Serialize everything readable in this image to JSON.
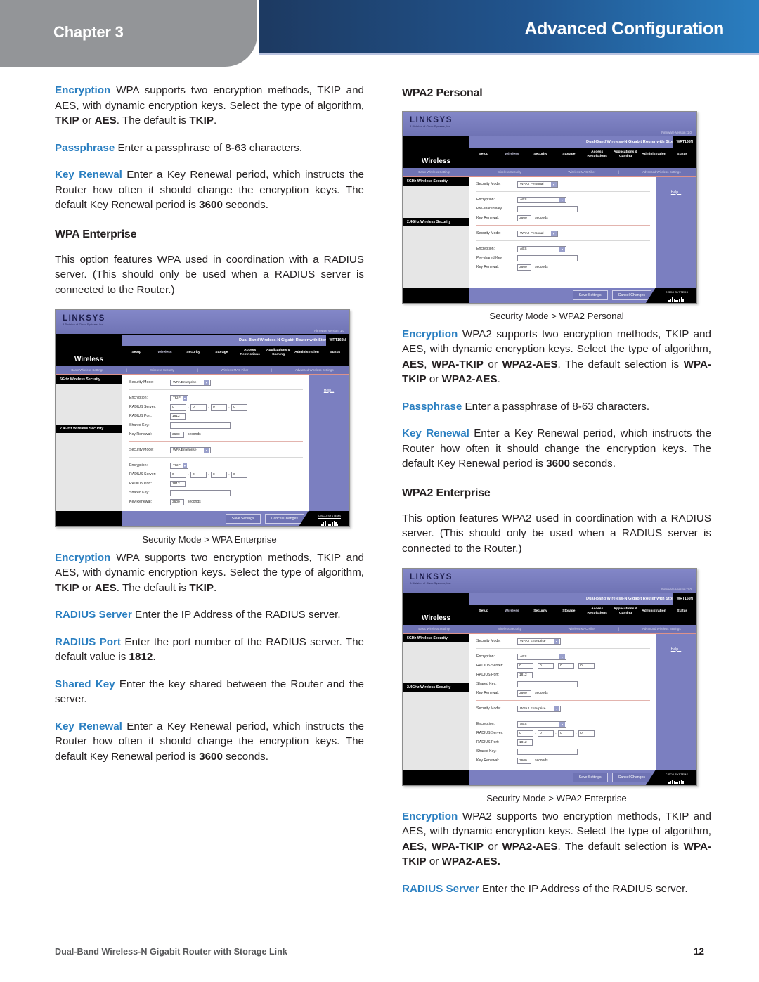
{
  "header": {
    "chapter": "Chapter 3",
    "title": "Advanced Configuration"
  },
  "left_column": {
    "para_encryption_wpa": {
      "term": "Encryption",
      "text_1": "  WPA supports two encryption methods, TKIP and AES, with dynamic encryption keys. Select the type of algorithm, ",
      "bold_1": "TKIP",
      "text_2": " or ",
      "bold_2": "AES",
      "text_3": ".  The default is ",
      "bold_3": "TKIP",
      "text_4": "."
    },
    "para_passphrase": {
      "term": "Passphrase",
      "text_1": "  Enter a passphrase of 8-63 characters."
    },
    "para_key_renewal": {
      "term": "Key Renewal",
      "text_1": "  Enter a Key Renewal period, which instructs the Router how often it should change the encryption keys. The default Key Renewal period is ",
      "bold_1": "3600",
      "text_2": " seconds."
    },
    "heading_wpa_enterprise": "WPA Enterprise",
    "para_wpa_enterprise_intro": "This option features WPA used in coordination with a RADIUS server. (This should only be used when a RADIUS server is connected to the Router.)",
    "figure_caption": "Security Mode > WPA Enterprise",
    "para_encryption_wpa2": {
      "term": "Encryption",
      "text_1": "  WPA supports two encryption methods, TKIP and AES, with dynamic encryption keys. Select the type of algorithm, ",
      "bold_1": "TKIP",
      "text_2": " or ",
      "bold_2": "AES",
      "text_3": ". The default is ",
      "bold_3": "TKIP",
      "text_4": "."
    },
    "para_radius_server": {
      "term": "RADIUS Server",
      "text_1": "  Enter the IP Address of the RADIUS server."
    },
    "para_radius_port": {
      "term": "RADIUS Port",
      "text_1": "  Enter the port number of the RADIUS server. The default value is ",
      "bold_1": "1812",
      "text_2": "."
    },
    "para_shared_key": {
      "term": "Shared Key",
      "text_1": "  Enter the key shared between the Router and the server."
    },
    "para_key_renewal_2": {
      "term": "Key Renewal",
      "text_1": "  Enter a Key Renewal period, which instructs the Router how often it should change the encryption keys. The default Key Renewal period is ",
      "bold_1": "3600",
      "text_2": " seconds."
    }
  },
  "right_column": {
    "heading_wpa2_personal": "WPA2 Personal",
    "figure_caption_1": "Security Mode > WPA2 Personal",
    "para_encryption_1": {
      "term": "Encryption",
      "text_1": " WPA2 supports two encryption methods, TKIP and AES, with dynamic encryption keys. Select the type of algorithm, ",
      "bold_1": "AES",
      "text_2": ", ",
      "bold_2": "WPA-TKIP",
      "text_3": " or ",
      "bold_3": "WPA2-AES",
      "text_4": ". The default selection is ",
      "bold_4": "WPA-TKIP",
      "text_5": " or ",
      "bold_5": "WPA2-AES",
      "text_6": "."
    },
    "para_passphrase": {
      "term": "Passphrase",
      "text_1": "  Enter a passphrase of 8-63 characters."
    },
    "para_key_renewal": {
      "term": "Key Renewal",
      "text_1": "  Enter a Key Renewal period, which instructs the Router how often it should change the encryption keys. The default Key Renewal period is ",
      "bold_1": "3600",
      "text_2": " seconds."
    },
    "heading_wpa2_enterprise": "WPA2 Enterprise",
    "para_wpa2_enterprise_intro": "This option features WPA2 used in coordination with a RADIUS server. (This should only be used when a RADIUS server is connected to the Router.)",
    "figure_caption_2": "Security Mode > WPA2 Enterprise",
    "para_encryption_2": {
      "term": "Encryption",
      "text_1": " WPA2 supports two encryption methods, TKIP and AES, with dynamic encryption keys. Select the type of algorithm, ",
      "bold_1": "AES",
      "text_2": ", ",
      "bold_2": "WPA-TKIP",
      "text_3": " or ",
      "bold_3": "WPA2-AES",
      "text_4": ". The default selection is ",
      "bold_4": "WPA-TKIP",
      "text_5": " or ",
      "bold_5": "WPA2-AES.",
      "text_6": ""
    },
    "para_radius_server": {
      "term": "RADIUS Server",
      "text_1": " Enter the IP Address of the RADIUS server."
    }
  },
  "router_ui": {
    "brand": "LINKSYS",
    "brand_sub": "A Division of Cisco Systems, Inc.",
    "firmware": "Firmware Version: 1.0",
    "model_name": "Dual-Band Wireless-N Gigabit Router with Storage Link",
    "model_number": "WRT160N",
    "section_title": "Wireless",
    "tabs": [
      "Setup",
      "Wireless",
      "Security",
      "Storage",
      "Access Restrictions",
      "Applications & Gaming",
      "Administration",
      "Status"
    ],
    "active_tab": "Wireless",
    "subtabs": [
      "Basic Wireless Settings",
      "Wireless Security",
      "Wireless MAC Filter",
      "Advanced Wireless Settings"
    ],
    "side_5ghz": "5GHz Wireless Security",
    "side_24ghz": "2.4GHz Wireless Security",
    "help_label": "Help...",
    "labels": {
      "security_mode": "Security Mode:",
      "encryption": "Encryption:",
      "pre_shared_key": "Pre-shared Key:",
      "key_renewal": "Key Renewal:",
      "radius_server": "RADIUS Server:",
      "radius_port": "RADIUS Port:",
      "shared_key": "Shared Key:",
      "seconds": "seconds"
    },
    "buttons": {
      "save": "Save Settings",
      "cancel": "Cancel Changes"
    },
    "cisco_text": "CISCO SYSTEMS",
    "wpa_enterprise": {
      "security_mode": "WPA Enterprise",
      "encryption": "TKIP",
      "radius_server_octets": [
        "0",
        "0",
        "0",
        "0"
      ],
      "radius_port": "1812",
      "shared_key": "",
      "key_renewal": "3600"
    },
    "wpa2_personal": {
      "security_mode": "WPA2 Personal",
      "encryption": "AES",
      "pre_shared_key": "",
      "key_renewal": "3600"
    },
    "wpa2_enterprise": {
      "security_mode": "WPA2 Enterprise",
      "encryption": "AES",
      "radius_server_octets": [
        "0",
        "0",
        "0",
        "0"
      ],
      "radius_port": "1812",
      "shared_key": "",
      "key_renewal": "3600"
    }
  },
  "footer": {
    "text": "Dual-Band Wireless-N Gigabit Router with Storage Link",
    "page": "12"
  },
  "colors": {
    "term_blue": "#2a7fc1",
    "header_navy": "#1d3557",
    "header_blue": "#2a7ec0",
    "chapter_gray": "#939598",
    "footer_gray": "#58595b"
  }
}
